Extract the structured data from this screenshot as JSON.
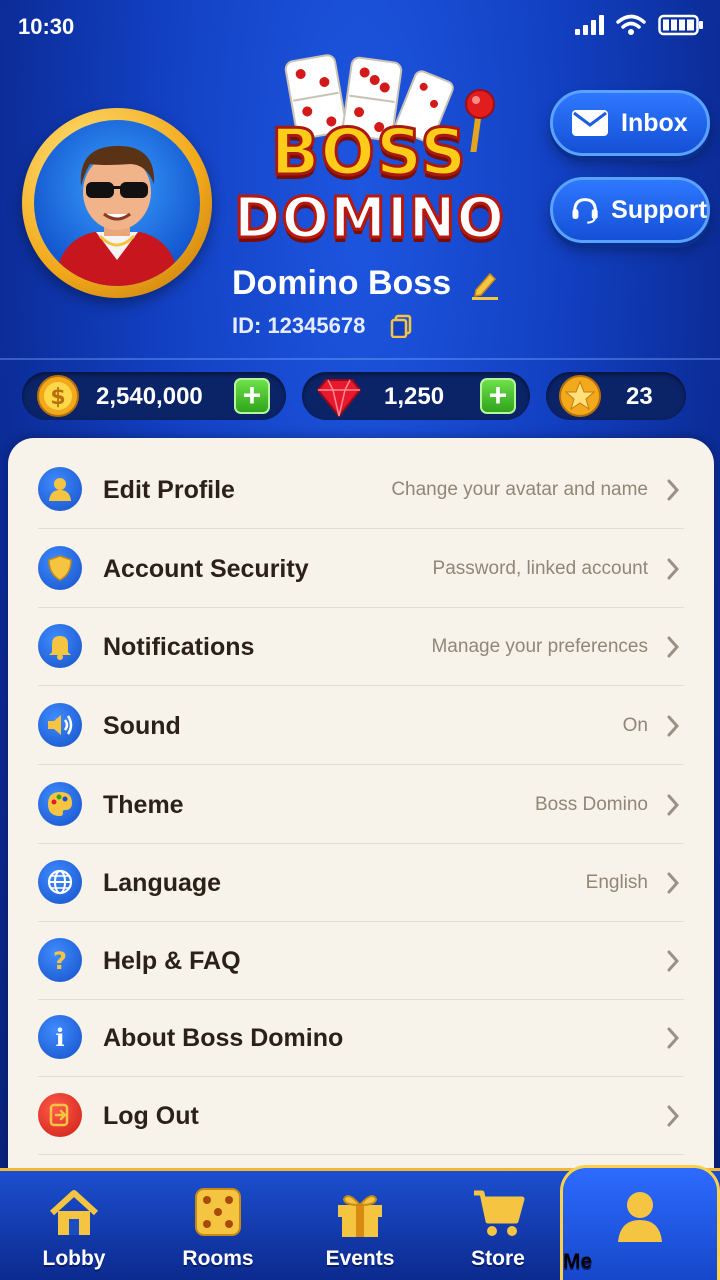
{
  "status_bar": {
    "time": "10:30"
  },
  "header": {
    "logo_line1": "BOSS",
    "logo_line2": "DOMINO",
    "inbox_label": "Inbox",
    "support_label": "Support",
    "username": "Domino Boss",
    "user_id": "ID: 12345678"
  },
  "currencies": {
    "coins": "2,540,000",
    "gems": "1,250",
    "stars": "23"
  },
  "settings": [
    {
      "label": "Edit Profile",
      "value": "Change your avatar and name",
      "icon": "person-icon"
    },
    {
      "label": "Account Security",
      "value": "Password, linked account",
      "icon": "shield-icon"
    },
    {
      "label": "Notifications",
      "value": "Manage your preferences",
      "icon": "bell-icon"
    },
    {
      "label": "Sound",
      "value": "On",
      "icon": "speaker-icon"
    },
    {
      "label": "Theme",
      "value": "Boss Domino",
      "icon": "palette-icon"
    },
    {
      "label": "Language",
      "value": "English",
      "icon": "globe-icon"
    },
    {
      "label": "Help & FAQ",
      "value": "",
      "icon": "question-icon"
    },
    {
      "label": "About Boss Domino",
      "value": "",
      "icon": "info-icon"
    },
    {
      "label": "Log Out",
      "value": "",
      "icon": "logout-icon"
    }
  ],
  "nav": {
    "lobby": "Lobby",
    "rooms": "Rooms",
    "events": "Events",
    "store": "Store",
    "me": "Me",
    "active": "Me"
  },
  "colors": {
    "background": "#1240c2",
    "panel": "#f7f3ea",
    "accent_gold": "#ffcc1a",
    "plus_green": "#2fa41c"
  }
}
